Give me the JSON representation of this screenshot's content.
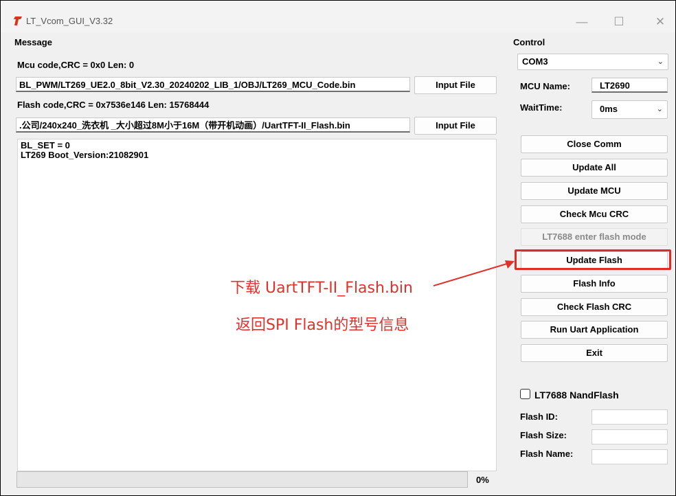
{
  "window": {
    "title": "LT_Vcom_GUI_V3.32",
    "minimize_symbol": "—",
    "maximize_symbol": "☐",
    "close_symbol": "✕"
  },
  "message": {
    "heading": "Message",
    "mcu_code_label": "Mcu code,CRC = 0x0  Len: 0",
    "mcu_file_path": "BL_PWM/LT269_UE2.0_8bit_V2.30_20240202_LIB_1/OBJ/LT269_MCU_Code.bin",
    "flash_code_label": "Flash code,CRC = 0x7536e146  Len: 15768444",
    "flash_file_path": ".公司/240x240_洗衣机 _大小超过8M小于16M（带开机动画）/UartTFT-II_Flash.bin",
    "input_file_label": "Input File",
    "log_lines": [
      "BL_SET = 0",
      "LT269 Boot_Version:21082901"
    ],
    "progress_value": 0,
    "progress_text": "0%"
  },
  "control": {
    "heading": "Control",
    "com_port": "COM3",
    "mcu_name_label": "MCU Name:",
    "mcu_name_value": "LT2690",
    "wait_time_label": "WaitTime:",
    "wait_time_value": "0ms",
    "buttons": {
      "close_comm": "Close Comm",
      "update_all": "Update All",
      "update_mcu": "Update MCU",
      "check_mcu_crc": "Check Mcu CRC",
      "lt7688_flash_mode": "LT7688 enter flash mode",
      "update_flash": "Update Flash",
      "flash_info": "Flash Info",
      "check_flash_crc": "Check Flash CRC",
      "run_uart_app": "Run Uart Application",
      "exit": "Exit"
    },
    "nandflash_label": "LT7688 NandFlash",
    "nandflash_checked": false,
    "flash_id_label": "Flash ID:",
    "flash_size_label": "Flash Size:",
    "flash_name_label": "Flash Name:"
  },
  "annotation": {
    "line1": "下载 UartTFT-II_Flash.bin",
    "line2": "返回SPI Flash的型号信息",
    "color": "#e0312b"
  },
  "colors": {
    "window_bg": "#f0f0f0",
    "highlight": "#e02b27",
    "progress_fill": "#06b025"
  },
  "icons": {
    "app": "app-logo-icon",
    "dropdown": "chevron-down-icon"
  }
}
